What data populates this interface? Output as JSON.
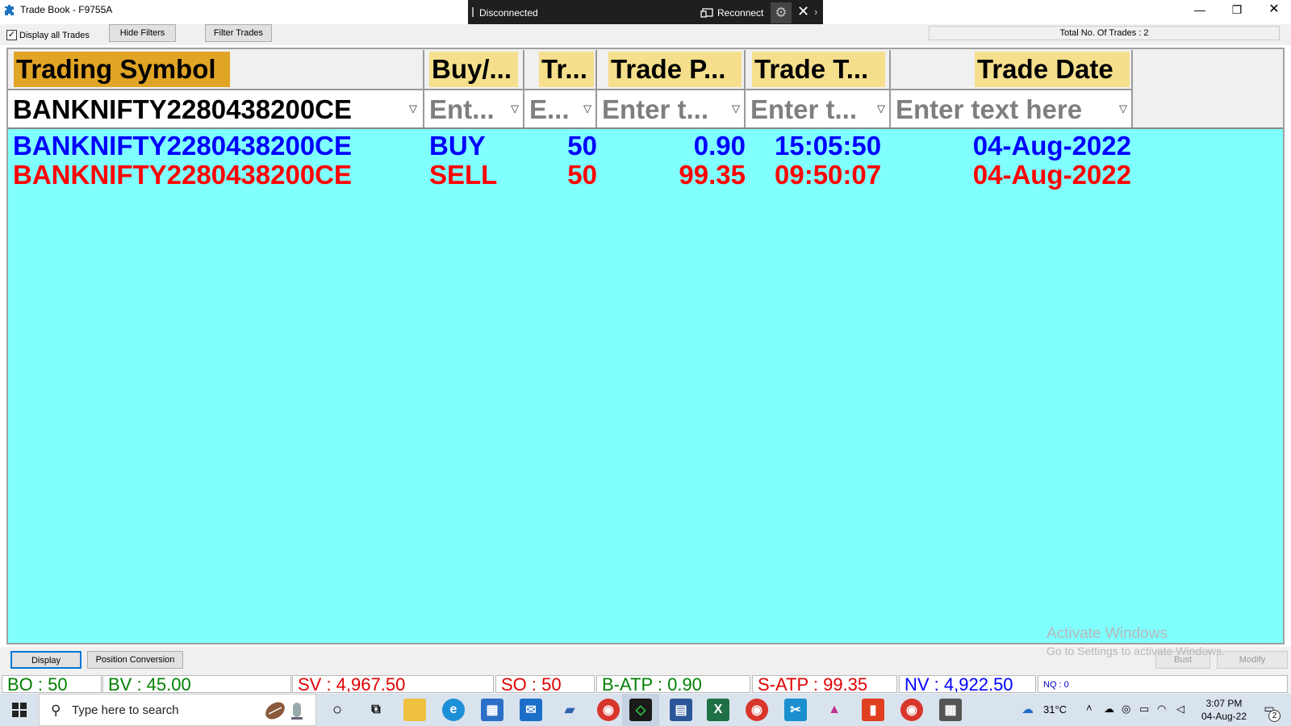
{
  "window": {
    "title": "Trade Book - F9755A",
    "minimize": "—",
    "maximize": "❐",
    "close": "✕"
  },
  "connection": {
    "status": "Disconnected",
    "reconnect_label": "Reconnect",
    "close": "✕",
    "more": "›"
  },
  "toolbar": {
    "display_all_label": "Display all Trades",
    "display_all_checked": true,
    "check_mark": "✓",
    "hide_filters": "Hide Filters",
    "filter_trades": "Filter Trades",
    "total_trades": "Total No. Of Trades : 2"
  },
  "grid": {
    "columns": [
      {
        "label": "Trading Symbol",
        "filter_value": "BANKNIFTY2280438200CE",
        "filter_placeholder": ""
      },
      {
        "label": "Buy/...",
        "filter_value": "",
        "filter_placeholder": "Ent..."
      },
      {
        "label": "Tr...",
        "filter_value": "",
        "filter_placeholder": "E..."
      },
      {
        "label": "Trade P...",
        "filter_value": "",
        "filter_placeholder": "Enter t..."
      },
      {
        "label": "Trade T...",
        "filter_value": "",
        "filter_placeholder": "Enter t..."
      },
      {
        "label": "Trade Date",
        "filter_value": "",
        "filter_placeholder": "Enter text here"
      }
    ],
    "rows": [
      {
        "symbol": "BANKNIFTY2280438200CE",
        "side": "BUY",
        "qty": "50",
        "price": "0.90",
        "time": "15:05:50",
        "date": "04-Aug-2022"
      },
      {
        "symbol": "BANKNIFTY2280438200CE",
        "side": "SELL",
        "qty": "50",
        "price": "99.35",
        "time": "09:50:07",
        "date": "04-Aug-2022"
      }
    ],
    "colors": {
      "grid_bg": "#80ffff",
      "header_highlight_symbol": "#e1a526",
      "header_highlight": "#f5df8c",
      "buy": "#0000ff",
      "sell": "#ff0000"
    }
  },
  "bottom": {
    "display": "Display",
    "position_conversion": "Position Conversion",
    "bust": "Bust",
    "modify": "Modify",
    "activate_title": "Activate Windows",
    "activate_sub": "Go to Settings to activate Windows."
  },
  "status": {
    "bo": "BO : 50",
    "bv": "BV : 45.00",
    "sv": "SV : 4,967.50",
    "so": "SO : 50",
    "batp": "B-ATP : 0.90",
    "satp": "S-ATP : 99.35",
    "nv": "NV : 4,922.50",
    "nq": "NQ : 0"
  },
  "taskbar": {
    "search_placeholder": "Type here to search",
    "weather": "31°C",
    "time": "3:07 PM",
    "date": "04-Aug-22",
    "notifications": "2"
  }
}
